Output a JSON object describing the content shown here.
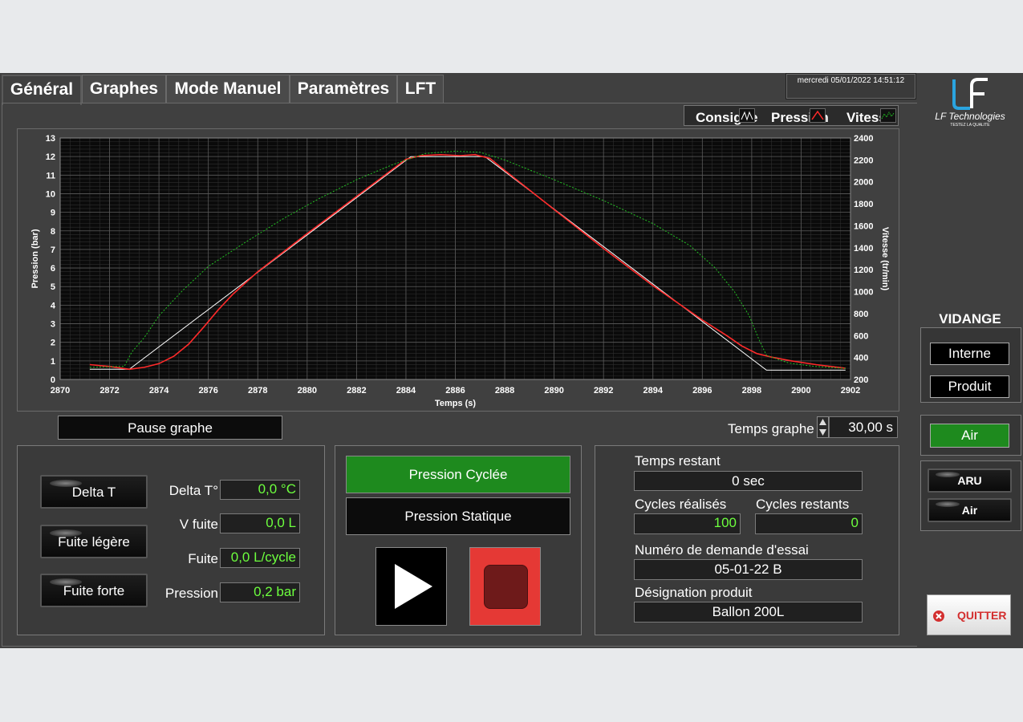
{
  "tabs": [
    "Général",
    "Graphes",
    "Mode Manuel",
    "Paramètres",
    "LFT"
  ],
  "datetime": "mercredi 05/01/2022 14:51:12",
  "logo": {
    "brand": "LF Technologies",
    "tagline": "TESTEZ LA QUALITE"
  },
  "legend": {
    "consigne": "Consigne",
    "pression": "Pression",
    "vitesse": "Vitesse"
  },
  "chart_data": {
    "type": "line",
    "xlabel": "Temps (s)",
    "ylabel": "Pression (bar)",
    "y2label": "Vitesse (tr/min)",
    "xlim": [
      2870,
      2902
    ],
    "ylim": [
      0,
      13
    ],
    "y2lim": [
      200,
      2400
    ],
    "xticks": [
      2870,
      2872,
      2874,
      2876,
      2878,
      2880,
      2882,
      2884,
      2886,
      2888,
      2890,
      2892,
      2894,
      2896,
      2898,
      2900,
      2902
    ],
    "yticks": [
      0,
      1,
      2,
      3,
      4,
      5,
      6,
      7,
      8,
      9,
      10,
      11,
      12,
      13
    ],
    "y2ticks": [
      200,
      400,
      600,
      800,
      1000,
      1200,
      1400,
      1600,
      1800,
      2000,
      2200,
      2400
    ],
    "series": [
      {
        "name": "Consigne",
        "color": "#ffffff",
        "axis": "left",
        "x": [
          2871.2,
          2872.8,
          2884.2,
          2887.2,
          2898.6,
          2901.8
        ],
        "y": [
          0.55,
          0.55,
          12.0,
          12.0,
          0.5,
          0.5
        ]
      },
      {
        "name": "Pression",
        "color": "#ff2a2a",
        "axis": "left",
        "x": [
          2871.2,
          2872.0,
          2872.8,
          2873.4,
          2874.0,
          2874.6,
          2875.2,
          2875.8,
          2876.4,
          2877.0,
          2878.0,
          2880.0,
          2882.0,
          2884.0,
          2884.6,
          2885.4,
          2886.2,
          2886.8,
          2887.4,
          2888.0,
          2890.0,
          2892.0,
          2894.0,
          2896.0,
          2897.0,
          2897.6,
          2898.2,
          2898.8,
          2899.6,
          2900.6,
          2901.8
        ],
        "y": [
          0.8,
          0.7,
          0.55,
          0.65,
          0.85,
          1.25,
          1.9,
          2.8,
          3.75,
          4.6,
          5.8,
          7.85,
          9.85,
          11.85,
          12.05,
          12.1,
          12.05,
          12.1,
          11.9,
          11.25,
          9.15,
          7.05,
          5.05,
          3.2,
          2.35,
          1.8,
          1.4,
          1.2,
          1.0,
          0.8,
          0.6
        ]
      },
      {
        "name": "Vitesse",
        "color": "#22c022",
        "axis": "right",
        "dashed": true,
        "x": [
          2871.2,
          2872.6,
          2872.9,
          2873.4,
          2874.0,
          2875.0,
          2876.0,
          2877.5,
          2879.0,
          2880.5,
          2882.0,
          2883.5,
          2884.8,
          2886.0,
          2887.0,
          2888.0,
          2890.0,
          2892.0,
          2894.0,
          2895.5,
          2896.5,
          2897.3,
          2897.9,
          2898.3,
          2898.6,
          2899.5,
          2900.5,
          2901.8
        ],
        "y": [
          310,
          320,
          450,
          580,
          780,
          1020,
          1230,
          1450,
          1660,
          1850,
          2020,
          2160,
          2260,
          2280,
          2270,
          2200,
          2020,
          1830,
          1620,
          1420,
          1220,
          1000,
          780,
          560,
          420,
          350,
          320,
          300
        ]
      }
    ]
  },
  "controls": {
    "pause": "Pause graphe",
    "temps_graphe_label": "Temps graphe",
    "temps_graphe_value": "30,00 s"
  },
  "alarms": [
    "Delta T",
    "Fuite légère",
    "Fuite forte"
  ],
  "measures": [
    {
      "label": "Delta T°",
      "value": "0,0 °C"
    },
    {
      "label": "V fuite",
      "value": "0,0 L"
    },
    {
      "label": "Fuite",
      "value": "0,0 L/cycle"
    },
    {
      "label": "Pression",
      "value": "0,2 bar"
    }
  ],
  "modes": {
    "cycled": "Pression Cyclée",
    "static": "Pression Statique"
  },
  "info": {
    "temps_restant_label": "Temps restant",
    "temps_restant": "0 sec",
    "cycles_realises_label": "Cycles réalisés",
    "cycles_realises": "100",
    "cycles_restants_label": "Cycles restants",
    "cycles_restants": "0",
    "demande_label": "Numéro de demande d'essai",
    "demande": "05-01-22 B",
    "designation_label": "Désignation produit",
    "designation": "Ballon 200L"
  },
  "vidange": {
    "title": "VIDANGE",
    "interne": "Interne",
    "produit": "Produit",
    "air": "Air"
  },
  "status": {
    "aru": "ARU",
    "air": "Air"
  },
  "quit": "QUITTER",
  "colors": {
    "active_green": "#1e8a1e",
    "stop_red": "#e53935",
    "value_green": "#6dff3e"
  }
}
